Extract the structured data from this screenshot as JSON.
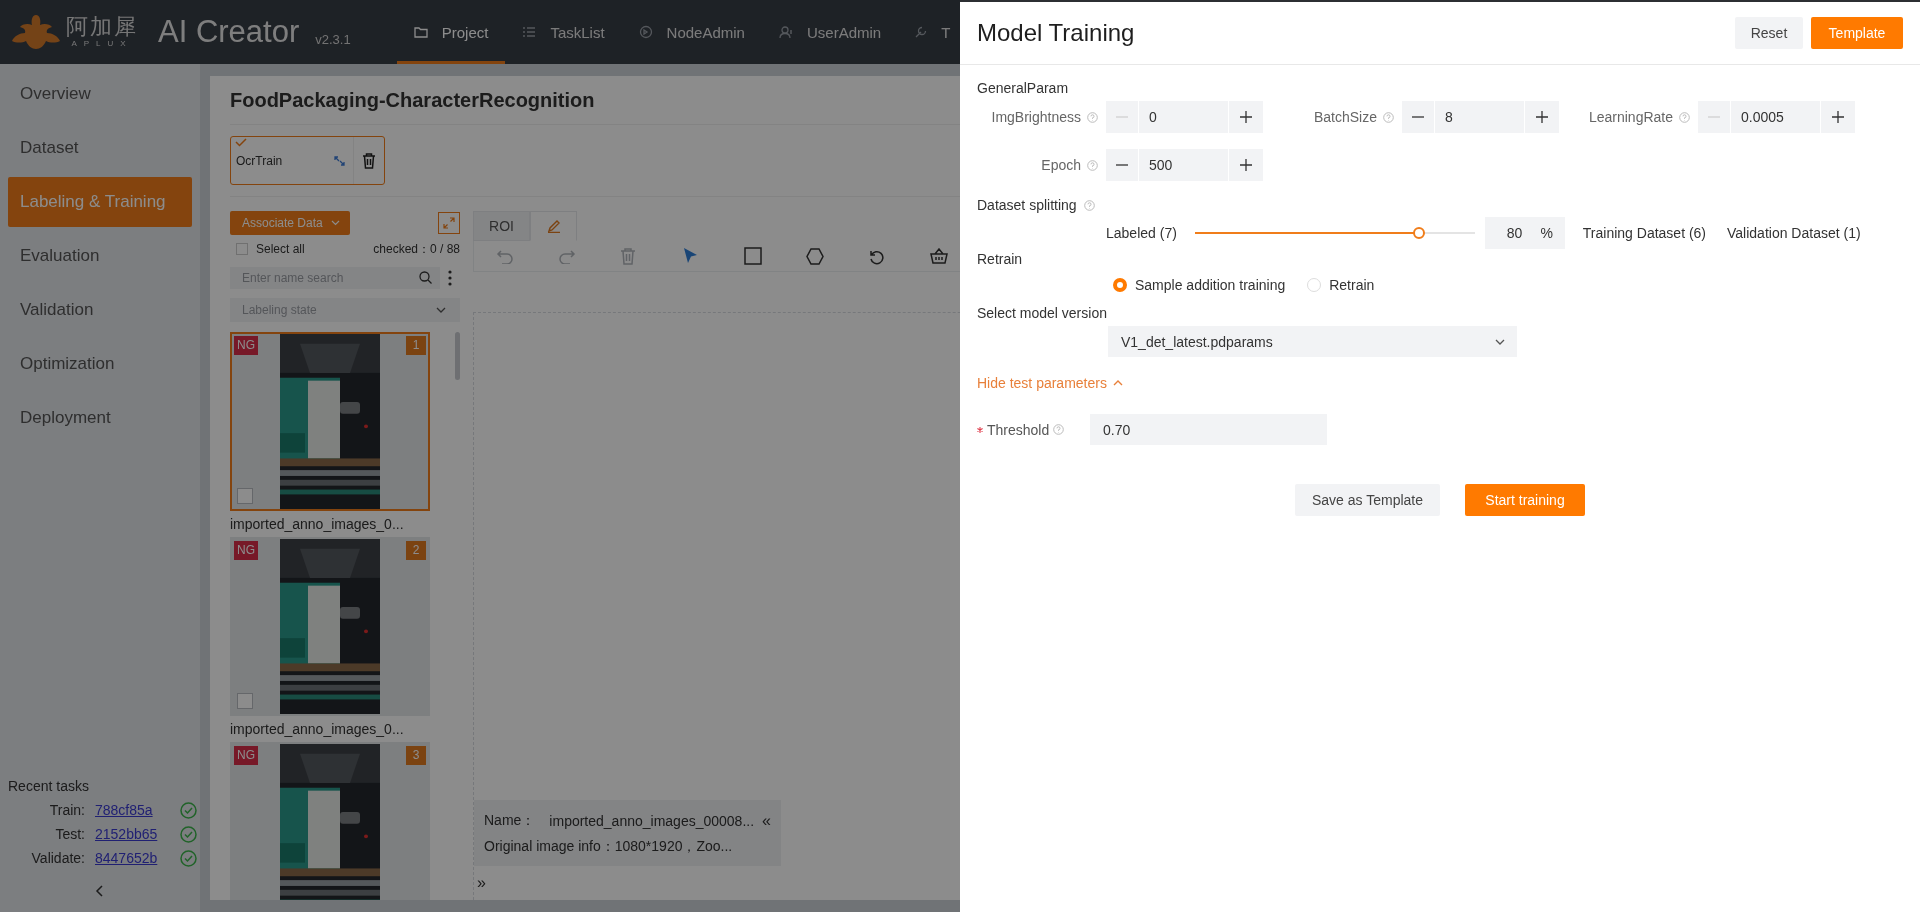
{
  "header": {
    "logo_cn": "阿加犀",
    "logo_en": "APLUX",
    "title": "AI Creator",
    "version": "v2.3.1",
    "nav": [
      {
        "label": "Project",
        "kind": "folder",
        "selected": true
      },
      {
        "label": "TaskList",
        "kind": "list",
        "selected": false
      },
      {
        "label": "NodeAdmin",
        "kind": "node",
        "selected": false
      },
      {
        "label": "UserAdmin",
        "kind": "user",
        "selected": false
      },
      {
        "label": "T",
        "kind": "wrench",
        "selected": false
      }
    ]
  },
  "sidebar": {
    "items": [
      {
        "label": "Overview",
        "selected": false
      },
      {
        "label": "Dataset",
        "selected": false
      },
      {
        "label": "Labeling & Training",
        "selected": true
      },
      {
        "label": "Evaluation",
        "selected": false
      },
      {
        "label": "Validation",
        "selected": false
      },
      {
        "label": "Optimization",
        "selected": false
      },
      {
        "label": "Deployment",
        "selected": false
      }
    ],
    "recent_tasks": {
      "title": "Recent tasks",
      "tasks": [
        {
          "label": "Train:",
          "id": "788cf85a",
          "done": true
        },
        {
          "label": "Test:",
          "id": "2152bb65",
          "done": true
        },
        {
          "label": "Validate:",
          "id": "8447652b",
          "done": true
        }
      ]
    }
  },
  "project": {
    "title": "FoodPackaging-CharacterRecognition",
    "tasks": [
      {
        "name": "OcrTrain",
        "checked": true
      }
    ],
    "associate_button": "Associate Data",
    "select_all": {
      "label": "Select all",
      "checked": false
    },
    "checked_count": "checked：0 / 88",
    "search": {
      "placeholder": "Enter name search"
    },
    "filter": {
      "placeholder": "Labeling state"
    },
    "images": [
      {
        "status": "NG",
        "index": "1",
        "name": "imported_anno_images_0...",
        "selected": true,
        "checked": false
      },
      {
        "status": "NG",
        "index": "2",
        "name": "imported_anno_images_0...",
        "selected": false,
        "checked": false
      },
      {
        "status": "NG",
        "index": "3",
        "selected": false
      }
    ]
  },
  "editor": {
    "tabs": [
      {
        "kind": "text",
        "label": "ROI",
        "selected": false
      },
      {
        "kind": "pencil",
        "selected": true
      }
    ],
    "tools": [
      {
        "kind": "undo",
        "selected": false,
        "disabled": true
      },
      {
        "kind": "redo",
        "selected": false,
        "disabled": true
      },
      {
        "kind": "delete",
        "selected": false,
        "disabled": true
      },
      {
        "kind": "pointer",
        "selected": true,
        "disabled": false
      },
      {
        "kind": "rectangle",
        "selected": false,
        "disabled": false
      },
      {
        "kind": "polygon",
        "selected": false,
        "disabled": false
      },
      {
        "kind": "rotate",
        "selected": false,
        "disabled": false
      },
      {
        "kind": "basket",
        "selected": false,
        "disabled": false
      }
    ],
    "info": {
      "name_label": "Name：",
      "name": "imported_anno_images_00008...",
      "original": "Original image info：1080*1920，Zoo...",
      "collapse": "«",
      "expand": "»"
    }
  },
  "drawer": {
    "title": "Model Training",
    "buttons": [
      {
        "label": "Reset",
        "kind": "default"
      },
      {
        "label": "Template",
        "kind": "primary"
      }
    ],
    "general_title": "GeneralParam",
    "params": [
      {
        "label": "ImgBrightness",
        "value": "0",
        "minus_disabled": true
      },
      {
        "label": "BatchSize",
        "value": "8",
        "minus_disabled": false
      },
      {
        "label": "LearningRate",
        "value": "0.0005",
        "minus_disabled": true
      },
      {
        "label": "Epoch",
        "value": "500",
        "minus_disabled": false
      }
    ],
    "dataset_splitting": {
      "title": "Dataset splitting",
      "labeled": "Labeled (7)",
      "level": 0.8,
      "value": "80",
      "unit": "%",
      "training": "Training Dataset (6)",
      "validation": "Validation Dataset (1)"
    },
    "retrain": {
      "title": "Retrain",
      "options": [
        {
          "label": "Sample addition training",
          "selected": true
        },
        {
          "label": "Retrain",
          "selected": false
        }
      ]
    },
    "model_version": {
      "label": "Select model version",
      "value": "V1_det_latest.pdparams"
    },
    "toggle": {
      "label": "Hide test parameters",
      "expanded": true
    },
    "threshold": {
      "label": "Threshold",
      "required": true,
      "value": "0.70"
    },
    "actions": [
      {
        "label": "Save as Template",
        "kind": "default"
      },
      {
        "label": "Start training",
        "kind": "primary"
      }
    ]
  }
}
